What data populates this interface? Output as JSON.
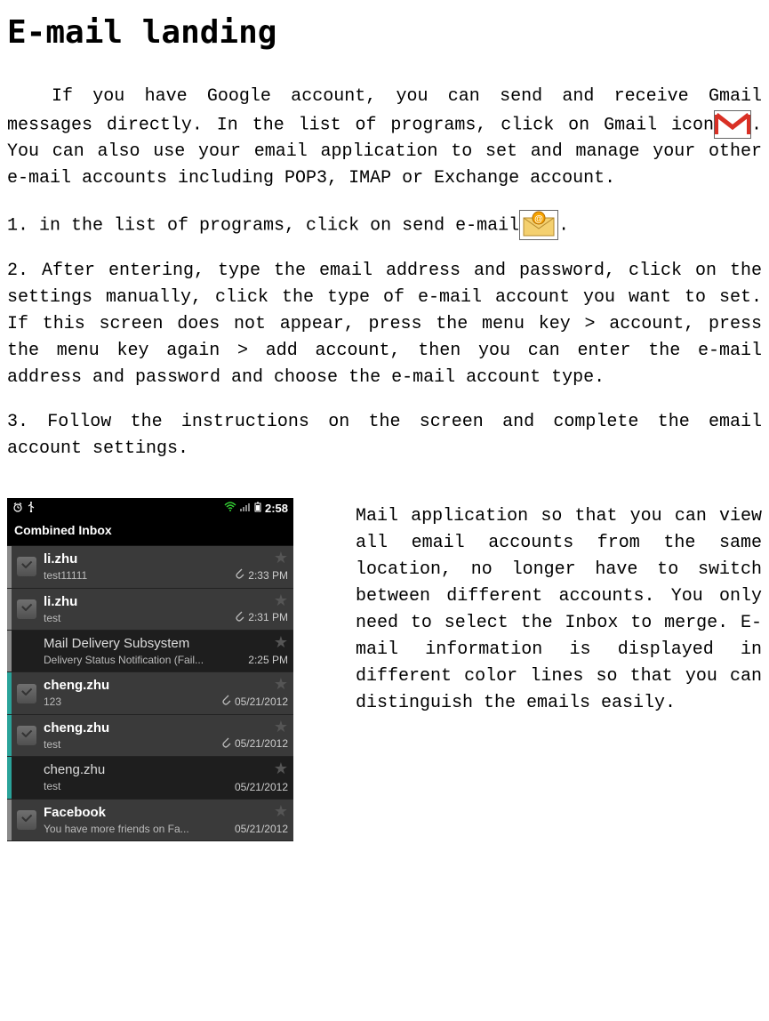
{
  "title": "E-mail landing",
  "intro_part1": "If you have Google account, you can send and receive Gmail messages directly. In the list of programs, click on Gmail icon",
  "intro_part2": ". You can also use your email application to set and manage your other e-mail accounts including POP3, IMAP or Exchange account.",
  "steps": {
    "s1a": "1. in the list of programs, click on send e-mail",
    "s1b": ".",
    "s2": "2. After entering, type the email address and password, click on the settings manually, click the type of e-mail account you want to set. If this screen does not appear, press the menu key > account, press the menu key again > add account, then you can enter the e-mail address and password and choose the e-mail account type.",
    "s3": "3. Follow the instructions on the screen and complete the email account settings."
  },
  "phone": {
    "time": "2:58",
    "header": "Combined Inbox",
    "items": [
      {
        "stripe": "#8a8a8a",
        "unread": true,
        "checkbox": true,
        "sender": "li.zhu",
        "subject": "test11111",
        "attach": true,
        "time": "2:33 PM"
      },
      {
        "stripe": "#8a8a8a",
        "unread": true,
        "checkbox": true,
        "sender": "li.zhu",
        "subject": "test",
        "attach": true,
        "time": "2:31 PM"
      },
      {
        "stripe": "#8a8a8a",
        "unread": false,
        "checkbox": false,
        "sender": "Mail Delivery Subsystem",
        "subject": "Delivery Status Notification (Fail...",
        "attach": false,
        "time": "2:25 PM"
      },
      {
        "stripe": "#2aa39a",
        "unread": true,
        "checkbox": true,
        "sender": "cheng.zhu",
        "subject": "123",
        "attach": true,
        "time": "05/21/2012"
      },
      {
        "stripe": "#2aa39a",
        "unread": true,
        "checkbox": true,
        "sender": "cheng.zhu",
        "subject": "test",
        "attach": true,
        "time": "05/21/2012"
      },
      {
        "stripe": "#2aa39a",
        "unread": false,
        "checkbox": false,
        "sender": "cheng.zhu",
        "subject": "test",
        "attach": false,
        "time": "05/21/2012"
      },
      {
        "stripe": "#8a8a8a",
        "unread": true,
        "checkbox": true,
        "sender": "Facebook",
        "subject": "You have more friends on Fa...",
        "attach": false,
        "time": "05/21/2012"
      }
    ]
  },
  "side_text": "Mail application so that you can view all email accounts from the same location, no longer have to switch between different accounts. You only need to select the Inbox to merge. E-mail information is displayed in different color lines so that you can distinguish the emails easily."
}
